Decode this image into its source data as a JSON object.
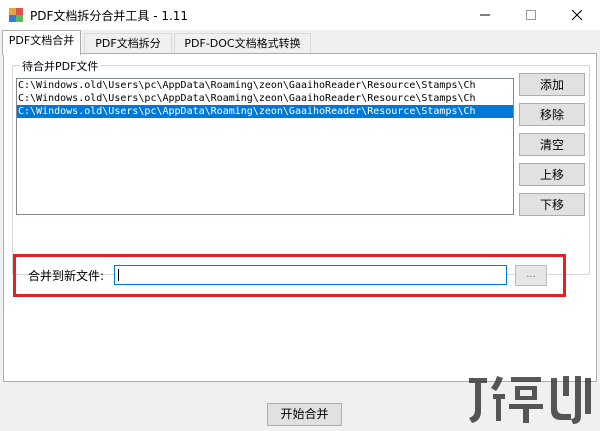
{
  "window": {
    "title": "PDF文档拆分合并工具 - 1.11",
    "controls": {
      "minimize": "—",
      "maximize": "☐",
      "close": "✕"
    }
  },
  "tabs": [
    {
      "label": "PDF文档合并",
      "active": true
    },
    {
      "label": "PDF文档拆分",
      "active": false
    },
    {
      "label": "PDF-DOC文档格式转换",
      "active": false
    }
  ],
  "merge_panel": {
    "group_label": "待合并PDF文件",
    "files": [
      {
        "path": "C:\\Windows.old\\Users\\pc\\AppData\\Roaming\\zeon\\GaaihoReader\\Resource\\Stamps\\Ch",
        "selected": false
      },
      {
        "path": "C:\\Windows.old\\Users\\pc\\AppData\\Roaming\\zeon\\GaaihoReader\\Resource\\Stamps\\Ch",
        "selected": false
      },
      {
        "path": "C:\\Windows.old\\Users\\pc\\AppData\\Roaming\\zeon\\GaaihoReader\\Resource\\Stamps\\Ch",
        "selected": true
      }
    ],
    "buttons": {
      "add": "添加",
      "remove": "移除",
      "clear": "清空",
      "move_up": "上移",
      "move_down": "下移"
    },
    "output_label": "合并到新文件:",
    "output_value": "",
    "browse_label": "...",
    "start_label": "开始合并"
  },
  "colors": {
    "selection": "#0078d7",
    "highlight_border": "#e32124",
    "accent": "#0078d7"
  }
}
